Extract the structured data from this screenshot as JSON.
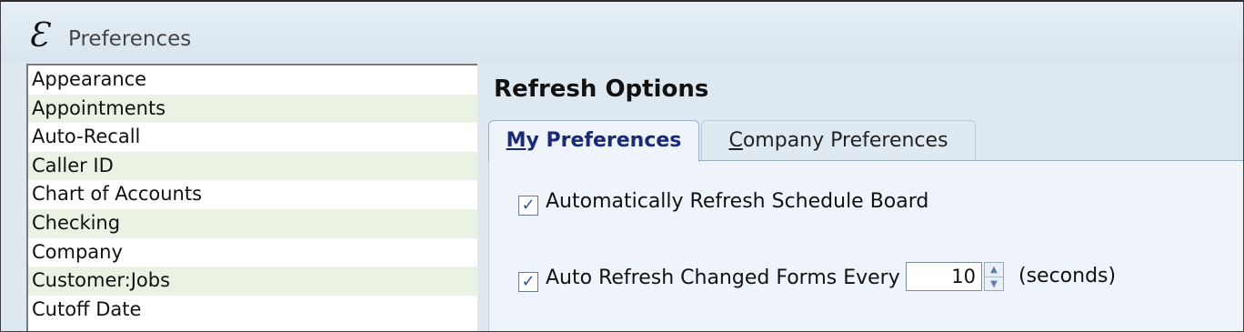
{
  "window": {
    "title": "Preferences",
    "icon_glyph": "Ɛ",
    "icon": "app-logo-icon"
  },
  "sidebar": {
    "items": [
      {
        "label": "Appearance"
      },
      {
        "label": "Appointments"
      },
      {
        "label": "Auto-Recall"
      },
      {
        "label": "Caller ID"
      },
      {
        "label": "Chart of Accounts"
      },
      {
        "label": "Checking"
      },
      {
        "label": "Company"
      },
      {
        "label": "Customer:Jobs"
      },
      {
        "label": "Cutoff Date"
      }
    ]
  },
  "main": {
    "section_title": "Refresh Options",
    "tabs": [
      {
        "accel": "M",
        "rest": "y Preferences",
        "active": true
      },
      {
        "accel": "C",
        "rest": "ompany Preferences",
        "active": false
      }
    ],
    "options": {
      "auto_refresh_board": {
        "label": "Automatically Refresh Schedule Board",
        "checked": true,
        "mark": "✓"
      },
      "auto_refresh_forms": {
        "label": "Auto Refresh Changed Forms Every",
        "checked": true,
        "mark": "✓"
      },
      "interval": {
        "value": "10",
        "unit": "(seconds)"
      }
    }
  },
  "colors": {
    "window_bg": "#dde8f1",
    "list_alt_row": "#e9f2e3",
    "active_tab_text": "#1a2a78"
  }
}
